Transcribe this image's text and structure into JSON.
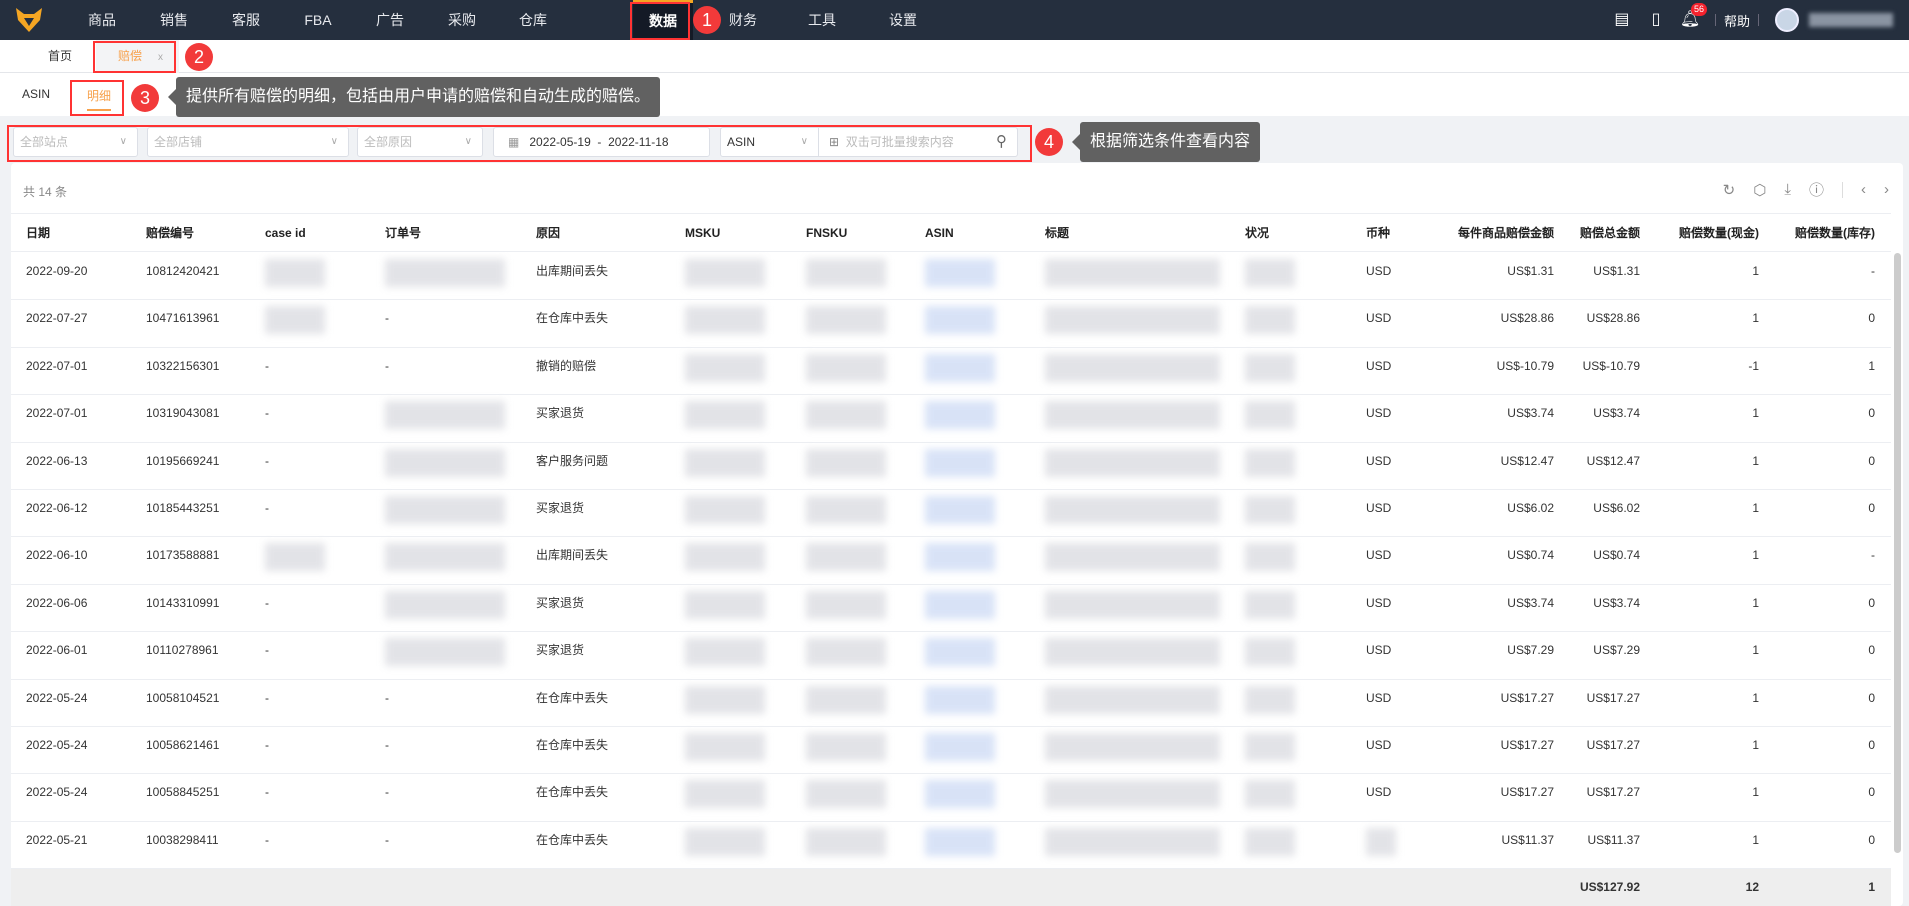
{
  "nav": {
    "items": [
      "商品",
      "销售",
      "客服",
      "FBA",
      "广告",
      "采购",
      "仓库",
      "数据",
      "财务",
      "工具",
      "设置"
    ],
    "active": "数据",
    "help": "帮助",
    "badge": "56",
    "brand_color": "#f5a623"
  },
  "tabs": {
    "home": "首页",
    "active": "赔偿",
    "close": "x"
  },
  "subtabs": {
    "asin": "ASIN",
    "detail": "明细"
  },
  "filters": {
    "site": "全部站点",
    "shop": "全部店铺",
    "reason": "全部原因",
    "date_start": "2022-05-19",
    "date_sep": "-",
    "date_end": "2022-11-18",
    "field": "ASIN",
    "search_placeholder": "双击可批量搜索内容"
  },
  "table": {
    "count": "共 14 条",
    "headers": [
      "日期",
      "赔偿编号",
      "case id",
      "订单号",
      "原因",
      "MSKU",
      "FNSKU",
      "ASIN",
      "标题",
      "状况",
      "币种",
      "每件商品赔偿金额",
      "赔偿总金额",
      "赔偿数量(现金)",
      "赔偿数量(库存)"
    ],
    "rows": [
      [
        "2022-09-20",
        "10812420421",
        "",
        "",
        "出库期间丢失",
        "USD",
        "US$1.31",
        "US$1.31",
        "1",
        "-"
      ],
      [
        "2022-07-27",
        "10471613961",
        "",
        "-",
        "在仓库中丢失",
        "USD",
        "US$28.86",
        "US$28.86",
        "1",
        "0"
      ],
      [
        "2022-07-01",
        "10322156301",
        "-",
        "-",
        "撤销的赔偿",
        "USD",
        "US$-10.79",
        "US$-10.79",
        "-1",
        "1"
      ],
      [
        "2022-07-01",
        "10319043081",
        "-",
        "",
        "买家退货",
        "USD",
        "US$3.74",
        "US$3.74",
        "1",
        "0"
      ],
      [
        "2022-06-13",
        "10195669241",
        "-",
        "",
        "客户服务问题",
        "USD",
        "US$12.47",
        "US$12.47",
        "1",
        "0"
      ],
      [
        "2022-06-12",
        "10185443251",
        "-",
        "",
        "买家退货",
        "USD",
        "US$6.02",
        "US$6.02",
        "1",
        "0"
      ],
      [
        "2022-06-10",
        "10173588881",
        "",
        "",
        "出库期间丢失",
        "USD",
        "US$0.74",
        "US$0.74",
        "1",
        "-"
      ],
      [
        "2022-06-06",
        "10143310991",
        "-",
        "",
        "买家退货",
        "USD",
        "US$3.74",
        "US$3.74",
        "1",
        "0"
      ],
      [
        "2022-06-01",
        "10110278961",
        "-",
        "",
        "买家退货",
        "USD",
        "US$7.29",
        "US$7.29",
        "1",
        "0"
      ],
      [
        "2022-05-24",
        "10058104521",
        "-",
        "-",
        "在仓库中丢失",
        "USD",
        "US$17.27",
        "US$17.27",
        "1",
        "0"
      ],
      [
        "2022-05-24",
        "10058621461",
        "-",
        "-",
        "在仓库中丢失",
        "USD",
        "US$17.27",
        "US$17.27",
        "1",
        "0"
      ],
      [
        "2022-05-24",
        "10058845251",
        "-",
        "-",
        "在仓库中丢失",
        "USD",
        "US$17.27",
        "US$17.27",
        "1",
        "0"
      ],
      [
        "2022-05-21",
        "10038298411",
        "-",
        "-",
        "在仓库中丢失",
        "",
        "US$11.37",
        "US$11.37",
        "1",
        "0"
      ]
    ],
    "totals": {
      "amount": "US$127.92",
      "cash": "12",
      "inventory": "1"
    }
  },
  "annotations": {
    "n1": "1",
    "n2": "2",
    "n3": "3",
    "n4": "4",
    "tip3": "提供所有赔偿的明细，包括由用户申请的赔偿和自动生成的赔偿。",
    "tip4": "根据筛选条件查看内容"
  }
}
